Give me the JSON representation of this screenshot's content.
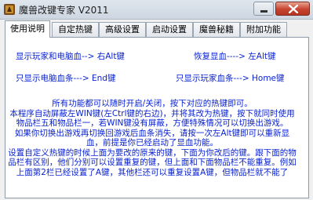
{
  "window": {
    "title": "魔兽改键专家 V2011"
  },
  "tabs": [
    {
      "label": "使用说明",
      "active": true
    },
    {
      "label": "自定热键",
      "active": false
    },
    {
      "label": "高级设置",
      "active": false
    },
    {
      "label": "启动设置",
      "active": false
    },
    {
      "label": "魔兽秘籍",
      "active": false
    },
    {
      "label": "附加功能",
      "active": false
    }
  ],
  "hotkeys": {
    "show_player_and_creep_hp": "显示玩家和电脑血--> 右Alt键",
    "restore_hp": "恢复显血----> 左Alt键",
    "only_creep_hp": "只显示电脑血条---> End键",
    "only_player_hp": "只显示玩家血条---> Home键"
  },
  "info_lines": [
    "所有功能都可以随时开启/关闭，按下对应的热键即可。",
    "本程序自动屏蔽左WIN键(左Ctrl键的右边)，并将其改为热键，按下就同时使用物品栏五和物品栏一，若WIN键没有屏蔽，方便特殊情况可以切换出游戏。",
    "如果你切换出游戏再切换回游戏后血条消失，请按一次左Alt键即可以重新显血，前提是你已经启动了显血功能。",
    "设置自定义热键的时候上面为要改的原来的键，下面为你改后的键。跟下面的物品栏有区别，他们分别可以设置重复的键，但上面和下面物品栏不能重复。例如上面第2栏已经设置了A键，其他栏还可以重复设置A键，但物品栏就不能了"
  ],
  "colors": {
    "info_text": "#0a22d0",
    "close_button": "#c7432f"
  }
}
